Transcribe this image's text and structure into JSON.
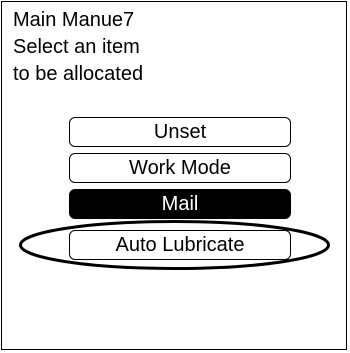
{
  "header": {
    "line1": "Main Manue7",
    "line2": "Select an item",
    "line3": "to be allocated"
  },
  "menu": {
    "items": [
      {
        "label": "Unset",
        "selected": false
      },
      {
        "label": "Work Mode",
        "selected": false
      },
      {
        "label": "Mail",
        "selected": true
      },
      {
        "label": "Auto Lubricate",
        "selected": false,
        "circled": true
      }
    ]
  },
  "colors": {
    "background": "#ffffff",
    "foreground": "#000000",
    "selected_background": "#000000",
    "selected_text": "#ffffff"
  }
}
